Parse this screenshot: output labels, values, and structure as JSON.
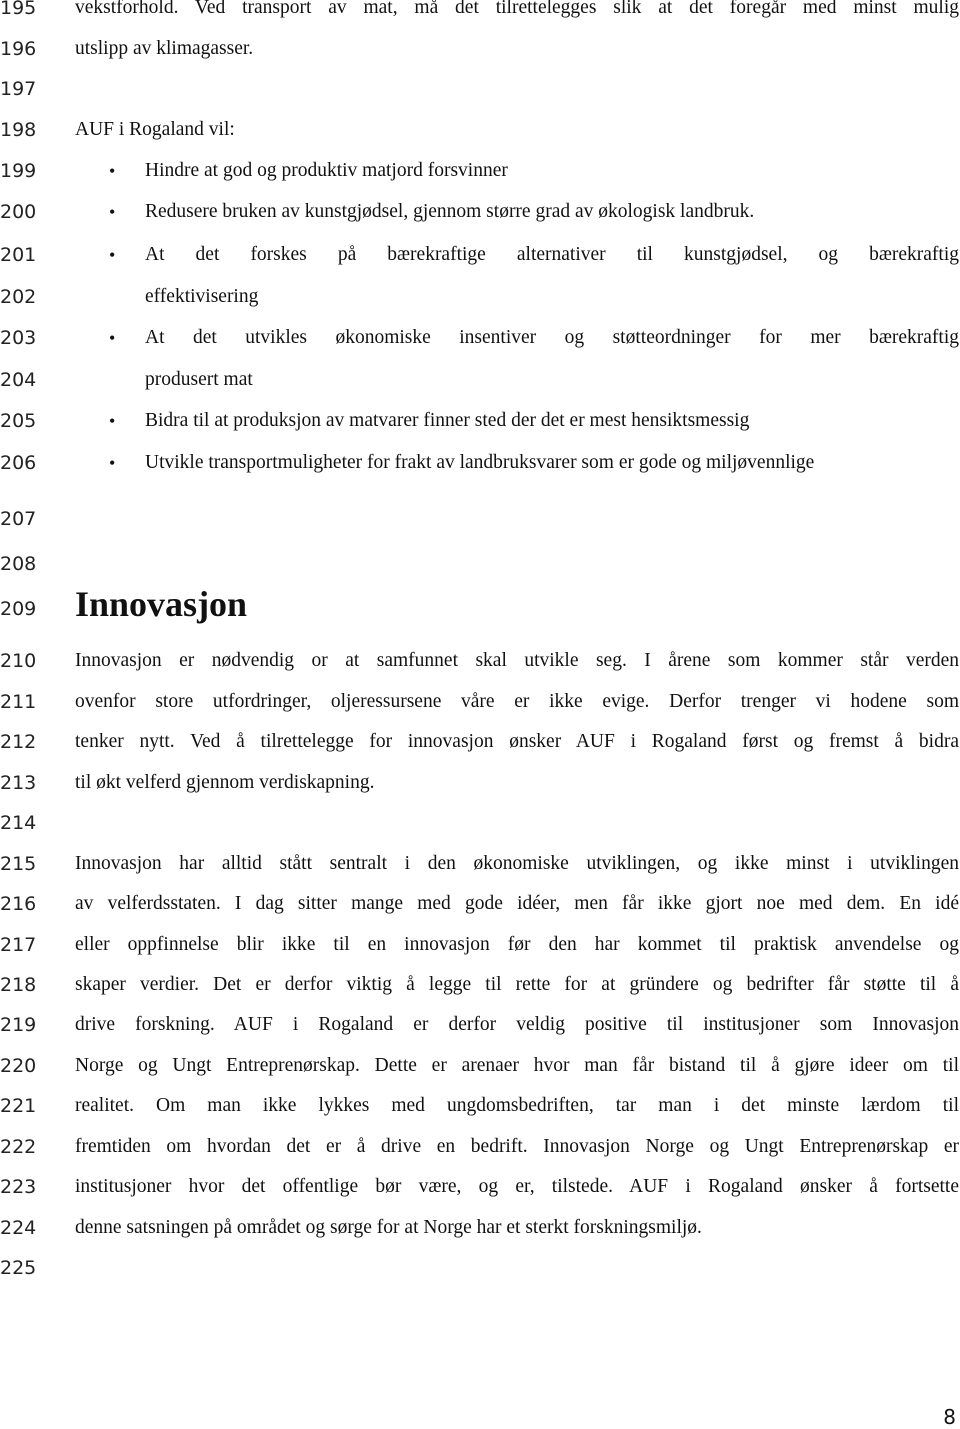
{
  "line_numbers": [
    "195",
    "196",
    "197",
    "198",
    "199",
    "200",
    "201",
    "202",
    "203",
    "204",
    "205",
    "206",
    "207",
    "208",
    "209",
    "210",
    "211",
    "212",
    "213",
    "214",
    "215",
    "216",
    "217",
    "218",
    "219",
    "220",
    "221",
    "222",
    "223",
    "224",
    "225"
  ],
  "intro": {
    "line1": "vekstforhold. Ved transport av mat, må det tilrettelegges slik at det foregår med minst mulig",
    "line2": "utslipp av klimagasser."
  },
  "auf_list": {
    "lead": "AUF i Rogaland vil:",
    "items": [
      {
        "lines": [
          "Hindre at god og produktiv matjord forsvinner"
        ]
      },
      {
        "lines": [
          "Redusere bruken av kunstgjødsel, gjennom større grad av økologisk landbruk."
        ]
      },
      {
        "lines": [
          "At det forskes på bærekraftige alternativer til kunstgjødsel, og bærekraftig",
          "effektivisering"
        ]
      },
      {
        "lines": [
          "At det utvikles økonomiske insentiver og støtteordninger for mer bærekraftig",
          "produsert mat"
        ]
      },
      {
        "lines": [
          "Bidra til at produksjon av matvarer finner sted der det er mest hensiktsmessig"
        ]
      },
      {
        "lines": [
          "Utvikle transportmuligheter for frakt av landbruksvarer som er gode og miljøvennlige"
        ]
      }
    ],
    "bullet_glyph": "•"
  },
  "section": {
    "heading": "Innovasjon",
    "paragraph1": [
      "Innovasjon er nødvendig or at samfunnet skal utvikle seg. I årene som kommer står verden",
      "ovenfor store utfordringer, oljeressursene våre er ikke evige. Derfor trenger vi hodene som",
      "tenker nytt. Ved å tilrettelegge for innovasjon ønsker AUF i Rogaland først og fremst å bidra",
      "til økt velferd gjennom verdiskapning."
    ],
    "paragraph2": [
      "Innovasjon har alltid stått sentralt i den økonomiske utviklingen, og ikke minst i utviklingen",
      "av velferdsstaten. I dag sitter mange med gode idéer, men får ikke gjort noe med dem. En idé",
      "eller oppfinnelse blir ikke til en innovasjon før den har kommet til praktisk anvendelse og",
      "skaper verdier. Det er derfor viktig å legge til rette for at gründere og bedrifter får støtte til å",
      "drive forskning. AUF i Rogaland er derfor veldig positive til institusjoner som Innovasjon",
      "Norge og Ungt Entreprenørskap. Dette er arenaer hvor man får bistand til å gjøre ideer om til",
      "realitet. Om man ikke lykkes med ungdomsbedriften, tar man i det minste lærdom til",
      "fremtiden om hvordan det er å drive en bedrift. Innovasjon Norge og Ungt Entreprenørskap er",
      "institusjoner hvor det offentlige bør være, og er, tilstede. AUF i Rogaland ønsker å fortsette",
      "denne satsningen på området og sørge for at Norge har et sterkt forskningsmiljø."
    ]
  },
  "page_number": "8"
}
